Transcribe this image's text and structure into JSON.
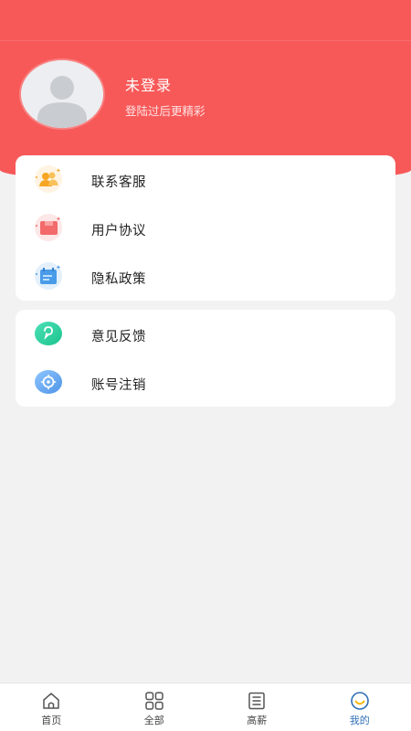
{
  "profile": {
    "name": "未登录",
    "subtitle": "登陆过后更精彩"
  },
  "menu_group_1": [
    {
      "label": "联系客服",
      "icon": "customer-service-icon"
    },
    {
      "label": "用户协议",
      "icon": "user-agreement-icon"
    },
    {
      "label": "隐私政策",
      "icon": "privacy-policy-icon"
    }
  ],
  "menu_group_2": [
    {
      "label": "意见反馈",
      "icon": "feedback-icon"
    },
    {
      "label": "账号注销",
      "icon": "account-cancel-icon"
    }
  ],
  "tabbar": [
    {
      "label": "首页",
      "icon": "home-icon",
      "active": false
    },
    {
      "label": "全部",
      "icon": "grid-icon",
      "active": false
    },
    {
      "label": "高薪",
      "icon": "list-icon",
      "active": false
    },
    {
      "label": "我的",
      "icon": "profile-smile-icon",
      "active": true
    }
  ],
  "colors": {
    "header": "#f75959",
    "active_tab": "#2f6fb5"
  }
}
